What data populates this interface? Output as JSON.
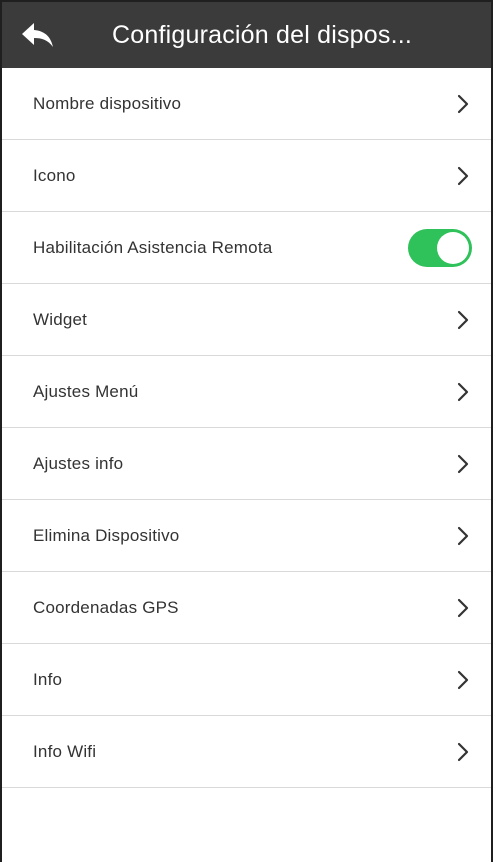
{
  "header": {
    "title": "Configuración del dispos...",
    "back_icon": "back-arrow-icon",
    "background_color": "#3b3b3b"
  },
  "list": {
    "items": [
      {
        "label": "Nombre dispositivo",
        "control": "chevron"
      },
      {
        "label": "Icono",
        "control": "chevron"
      },
      {
        "label": "Habilitación Asistencia Remota",
        "control": "toggle",
        "toggle_on": true,
        "toggle_color": "#2fc15a"
      },
      {
        "label": "Widget",
        "control": "chevron"
      },
      {
        "label": "Ajustes Menú",
        "control": "chevron"
      },
      {
        "label": "Ajustes info",
        "control": "chevron"
      },
      {
        "label": "Elimina Dispositivo",
        "control": "chevron"
      },
      {
        "label": "Coordenadas GPS",
        "control": "chevron"
      },
      {
        "label": "Info",
        "control": "chevron"
      },
      {
        "label": "Info Wifi",
        "control": "chevron"
      }
    ]
  }
}
